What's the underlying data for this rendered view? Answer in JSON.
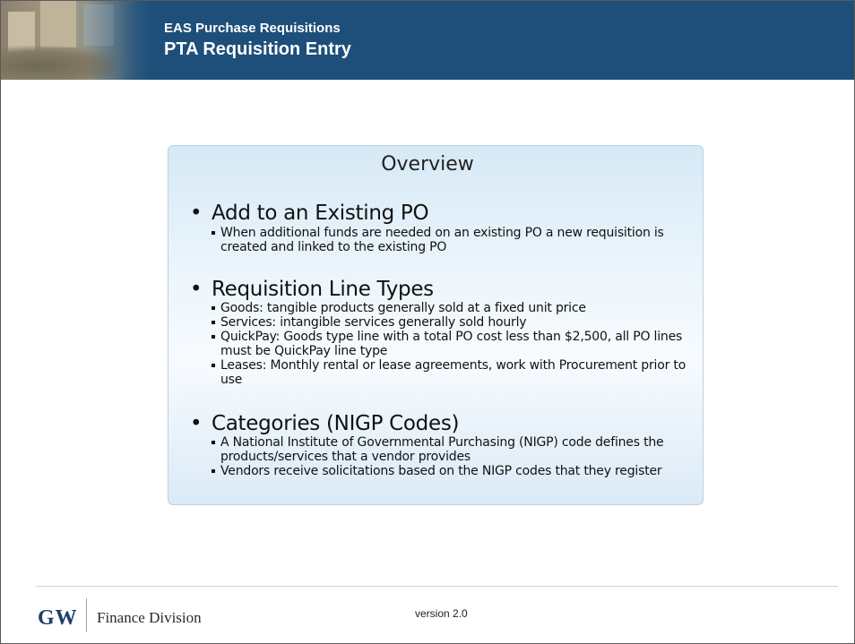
{
  "header": {
    "title": "EAS Purchase Requisitions",
    "subtitle": "PTA Requisition Entry"
  },
  "overview": {
    "title": "Overview",
    "sections": [
      {
        "heading": "Add to an Existing PO",
        "items": [
          "When additional funds are needed on an existing PO a new requisition is created and linked to the existing PO"
        ]
      },
      {
        "heading": "Requisition Line Types",
        "items": [
          "Goods:  tangible products generally sold at a fixed unit price",
          "Services: intangible services generally sold hourly",
          "QuickPay: Goods type line with a total PO cost less than $2,500, all PO lines must be QuickPay line type",
          "Leases: Monthly rental or lease agreements, work with Procurement prior to use"
        ]
      },
      {
        "heading": "Categories (NIGP Codes)",
        "items": [
          "A National Institute of Governmental Purchasing (NIGP) code defines the products/services that a vendor provides",
          "Vendors receive solicitations based on the NIGP codes that they register"
        ]
      }
    ]
  },
  "footer": {
    "logo_text": "GW",
    "division": "Finance Division",
    "version": "version 2.0"
  },
  "colors": {
    "header_bg": "#1d4f7a",
    "logo": "#1d3f6b"
  }
}
